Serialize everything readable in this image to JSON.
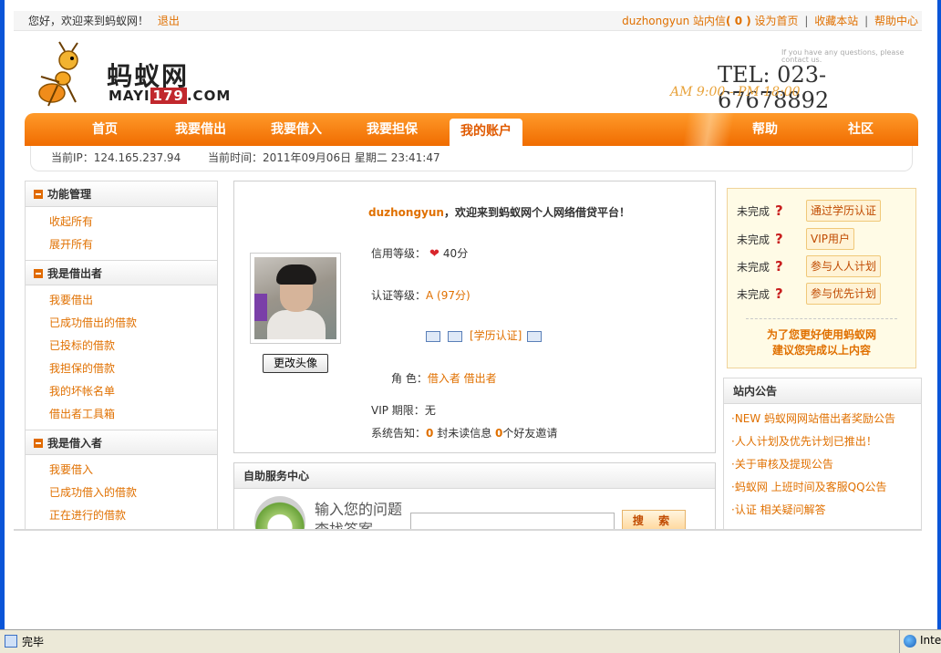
{
  "topbar": {
    "welcome": "您好，欢迎来到蚂蚁网！",
    "logout": "退出",
    "username": "duzhongyun",
    "inbox_label": "站内信",
    "inbox_count": "( 0 )",
    "set_home": "设为首页",
    "bookmark": "收藏本站",
    "help_center": "帮助中心",
    "separator": "|"
  },
  "header": {
    "logo_text": "蚂蚁网",
    "logo_sub_prefix": "MAYI",
    "logo_sub_num": "179",
    "logo_sub_suffix": ".COM",
    "contact_note": "If you have any questions, please contact us.",
    "tel": "TEL: 023- 67678892",
    "hours": "AM 9:00 - PM 18:00"
  },
  "nav": {
    "items": [
      {
        "label": "首页"
      },
      {
        "label": "我要借出"
      },
      {
        "label": "我要借入"
      },
      {
        "label": "我要担保"
      },
      {
        "label": "我的账户"
      },
      {
        "label": "帮助"
      },
      {
        "label": "社区"
      }
    ],
    "ip_info": "当前IP：124.165.237.94",
    "time_info": "当前时间：2011年09月06日 星期二 23:41:47"
  },
  "sidebar": {
    "sections": [
      {
        "title": "功能管理",
        "items": [
          "收起所有",
          "展开所有"
        ]
      },
      {
        "title": "我是借出者",
        "items": [
          "我要借出",
          "已成功借出的借款",
          "已投标的借款",
          "我担保的借款",
          "我的坏帐名单",
          "借出者工具箱"
        ]
      },
      {
        "title": "我是借入者",
        "items": [
          "我要借入",
          "已成功借入的借款",
          "正在进行的借款"
        ]
      }
    ]
  },
  "profile": {
    "username": "duzhongyun",
    "welcome_suffix": "，欢迎来到蚂蚁网个人网络借贷平台！",
    "change_photo": "更改头像",
    "credit_label": "信用等级：",
    "credit_value": "40分",
    "cert_label": "认证等级：",
    "cert_value": "A (97分)",
    "edu_cert": "[学历认证]",
    "role_label": "角 色：",
    "role_value": "借入者 借出者",
    "vip_label": "VIP 期限：",
    "vip_value": "无",
    "notice_label": "系统告知：",
    "unread_count": "0",
    "unread_text": "封未读信息",
    "friend_count": "0",
    "friend_text": "个好友邀请"
  },
  "service": {
    "title": "自助服务中心",
    "prompt_line1": "输入您的问题",
    "prompt_line2": "查找答案",
    "search_value": "",
    "search_button": "搜 索"
  },
  "tasks": {
    "items": [
      {
        "status": "未完成",
        "action": "通过学历认证"
      },
      {
        "status": "未完成",
        "action": "VIP用户"
      },
      {
        "status": "未完成",
        "action": "参与人人计划"
      },
      {
        "status": "未完成",
        "action": "参与优先计划"
      }
    ],
    "note_line1": "为了您更好使用蚂蚁网",
    "note_line2": "建议您完成以上内容"
  },
  "notice": {
    "title": "站内公告",
    "items": [
      "·NEW 蚂蚁网网站借出者奖励公告",
      "·人人计划及优先计划已推出！",
      "·关于审核及提现公告",
      "·蚂蚁网 上班时间及客服QQ公告",
      "·认证 相关疑问解答"
    ]
  },
  "statusbar": {
    "text": "完毕",
    "zone": "Inte"
  }
}
